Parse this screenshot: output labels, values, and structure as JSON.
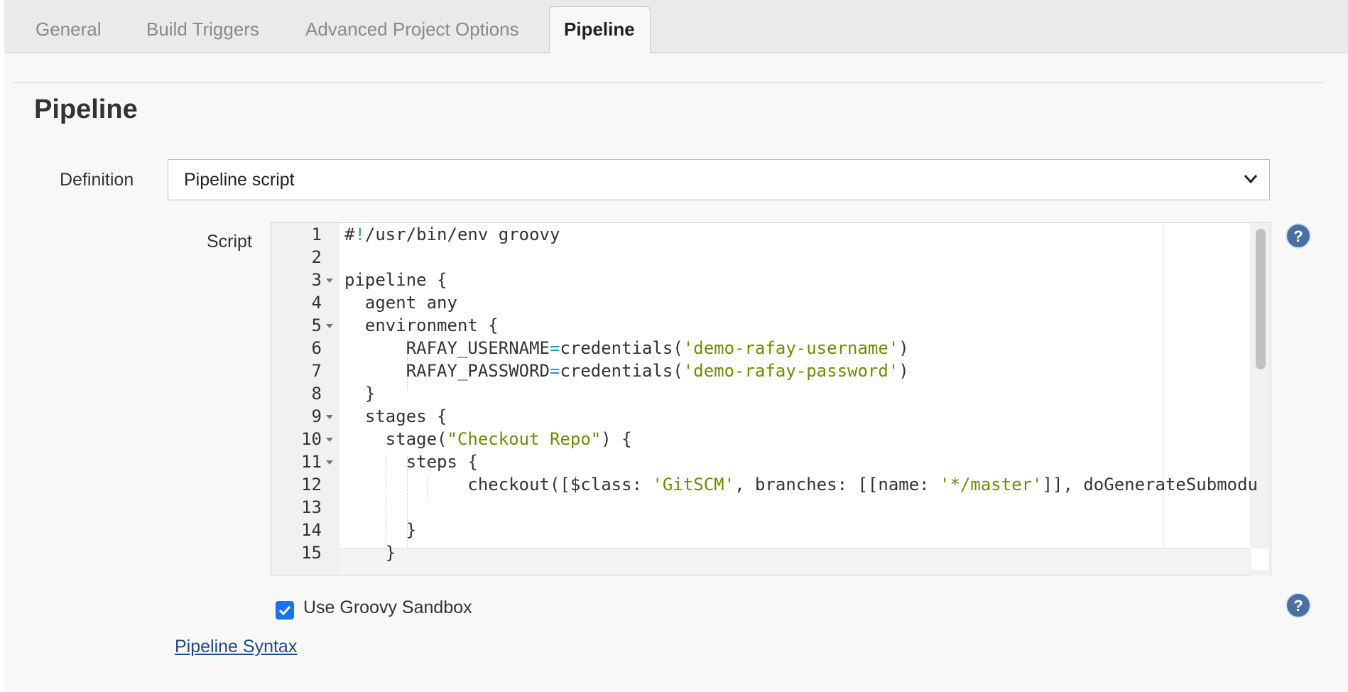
{
  "tabs": [
    {
      "label": "General"
    },
    {
      "label": "Build Triggers"
    },
    {
      "label": "Advanced Project Options"
    },
    {
      "label": "Pipeline"
    }
  ],
  "active_tab": "Pipeline",
  "section": {
    "title": "Pipeline"
  },
  "definition": {
    "label": "Definition",
    "value": "Pipeline script"
  },
  "script": {
    "label": "Script",
    "line_numbers": [
      "1",
      "2",
      "3",
      "4",
      "5",
      "6",
      "7",
      "8",
      "9",
      "10",
      "11",
      "12",
      "13",
      "14",
      "15"
    ],
    "lines": [
      "#!/usr/bin/env groovy",
      "",
      "pipeline {",
      "  agent any",
      "  environment {",
      "      RAFAY_USERNAME=credentials('demo-rafay-username')",
      "      RAFAY_PASSWORD=credentials('demo-rafay-password')",
      "  }",
      "  stages {",
      "    stage(\"Checkout Repo\") {",
      "      steps {",
      "            checkout([$class: 'GitSCM', branches: [[name: '*/master']], doGenerateSubmodu",
      "",
      "      }",
      "    }"
    ]
  },
  "sandbox": {
    "label": "Use Groovy Sandbox",
    "checked": true
  },
  "pipeline_syntax": {
    "label": "Pipeline Syntax"
  },
  "colors": {
    "string": "#6b8e00",
    "operator": "#2c99b8",
    "link": "#204a87",
    "checkbox": "#1a73e8",
    "help_icon": "#4a6fa5"
  }
}
